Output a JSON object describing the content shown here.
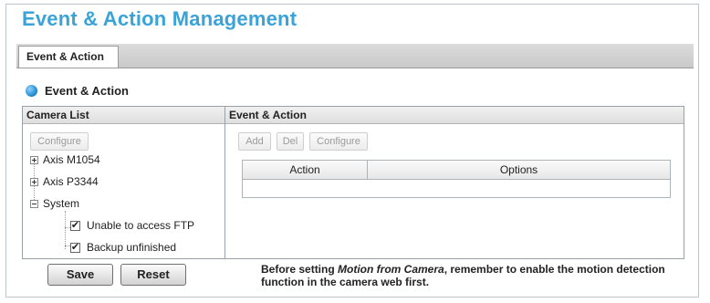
{
  "page": {
    "title": "Event & Action Management"
  },
  "tabs": [
    {
      "label": "Event & Action",
      "active": true
    }
  ],
  "section": {
    "title": "Event & Action",
    "icon": "blue-dot-icon"
  },
  "camera_list": {
    "header": "Camera List",
    "configure_label": "Configure",
    "tree": [
      {
        "label": "Axis M1054",
        "expanded": false
      },
      {
        "label": "Axis P3344",
        "expanded": false
      },
      {
        "label": "System",
        "expanded": true,
        "children": [
          {
            "label": "Unable to access FTP",
            "checked": true
          },
          {
            "label": "Backup unfinished",
            "checked": true
          }
        ]
      }
    ]
  },
  "event_action": {
    "header": "Event & Action",
    "add_label": "Add",
    "del_label": "Del",
    "configure_label": "Configure",
    "columns": [
      "Action",
      "Options"
    ]
  },
  "footer": {
    "save_label": "Save",
    "reset_label": "Reset",
    "note_prefix": "Before setting ",
    "note_emphasis": "Motion from Camera",
    "note_suffix": ", remember to enable the motion detection function in the camera web first."
  },
  "colors": {
    "title": "#3aa3d8",
    "accent_dot": "#1f8ad0"
  }
}
